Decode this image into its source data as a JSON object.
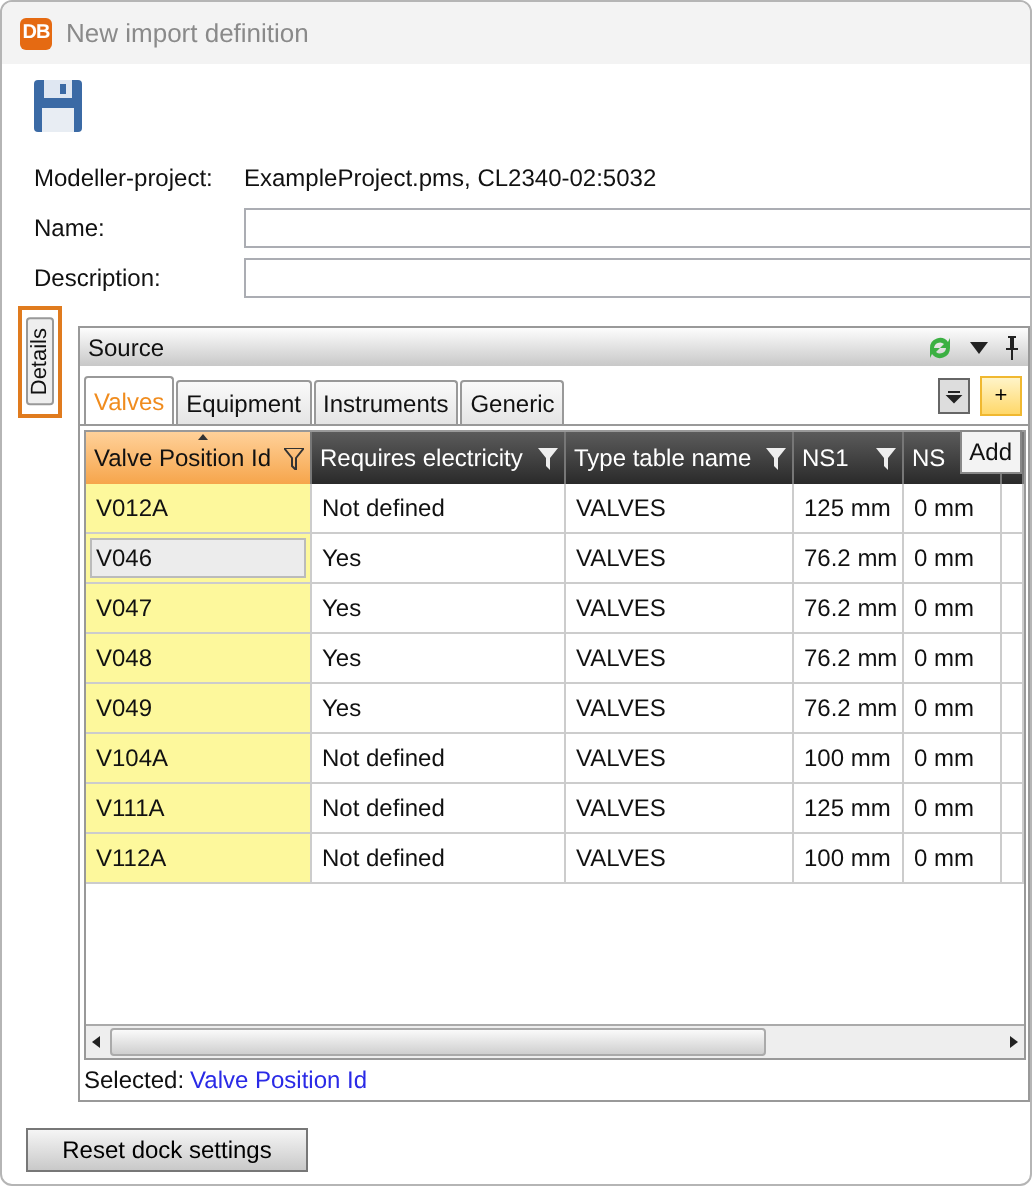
{
  "window": {
    "title": "New import definition",
    "badge": "DB"
  },
  "fields": [
    {
      "kind": "info",
      "label": "Modeller-project:",
      "value": "ExampleProject.pms, CL2340-02:5032"
    },
    {
      "kind": "input",
      "label": "Name:"
    },
    {
      "kind": "input",
      "label": "Description:"
    }
  ],
  "side_tab": {
    "label": "Details",
    "selected": true
  },
  "panel": {
    "title": "Source",
    "add_button": "+",
    "tooltip": "Add",
    "tabs": [
      {
        "label": "Valves",
        "selected": true
      },
      {
        "label": "Equipment",
        "selected": false
      },
      {
        "label": "Instruments",
        "selected": false
      },
      {
        "label": "Generic",
        "selected": false
      }
    ]
  },
  "table": {
    "columns": [
      {
        "label": "Valve Position Id",
        "selected": true,
        "sorted": true
      },
      {
        "label": "Requires electricity",
        "selected": false,
        "sorted": false
      },
      {
        "label": "Type table name",
        "selected": false,
        "sorted": false
      },
      {
        "label": "NS1",
        "selected": false,
        "sorted": false
      },
      {
        "label": "NS",
        "selected": false,
        "sorted": false
      }
    ],
    "rows": [
      {
        "cells": [
          "V012A",
          "Not defined",
          "VALVES",
          "125 mm",
          "0 mm"
        ],
        "selected": false
      },
      {
        "cells": [
          "V046",
          "Yes",
          "VALVES",
          "76.2 mm",
          "0 mm"
        ],
        "selected": true
      },
      {
        "cells": [
          "V047",
          "Yes",
          "VALVES",
          "76.2 mm",
          "0 mm"
        ],
        "selected": false
      },
      {
        "cells": [
          "V048",
          "Yes",
          "VALVES",
          "76.2 mm",
          "0 mm"
        ],
        "selected": false
      },
      {
        "cells": [
          "V049",
          "Yes",
          "VALVES",
          "76.2 mm",
          "0 mm"
        ],
        "selected": false
      },
      {
        "cells": [
          "V104A",
          "Not defined",
          "VALVES",
          "100 mm",
          "0 mm"
        ],
        "selected": false
      },
      {
        "cells": [
          "V111A",
          "Not defined",
          "VALVES",
          "125 mm",
          "0 mm"
        ],
        "selected": false
      },
      {
        "cells": [
          "V112A",
          "Not defined",
          "VALVES",
          "100 mm",
          "0 mm"
        ],
        "selected": false
      }
    ]
  },
  "status": {
    "label": "Selected:",
    "value": "Valve Position Id"
  },
  "buttons": [
    "Reset dock settings"
  ]
}
